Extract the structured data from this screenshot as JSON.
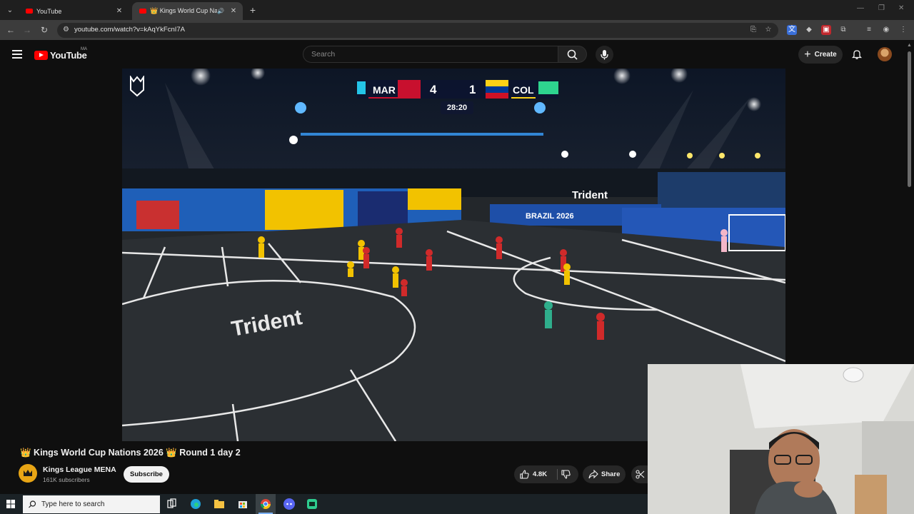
{
  "browser": {
    "tabs": [
      {
        "label": "YouTube",
        "active": false
      },
      {
        "label": "👑 Kings World Cup Natio",
        "active": true
      }
    ],
    "url": "youtube.com/watch?v=kAqYkFcnI7A"
  },
  "youtube": {
    "logo_text": "YouTube",
    "country_code": "MA",
    "search_placeholder": "Search",
    "create_label": "Create"
  },
  "video": {
    "scoreboard": {
      "home_team": "MAR",
      "home_score": "4",
      "away_team": "COL",
      "away_score": "1",
      "clock": "28:20"
    },
    "field_branding": {
      "center_logo": "Trident",
      "banner_right": "Trident",
      "board_text": "BRAZIL 2026"
    },
    "title": "👑 Kings World Cup Nations 2026 👑 Round 1 day 2",
    "channel": {
      "name": "Kings League MENA",
      "subscribers": "161K subscribers"
    },
    "subscribe_label": "Subscribe",
    "likes": "4.8K",
    "share_label": "Share"
  },
  "taskbar": {
    "search_placeholder": "Type here to search"
  },
  "colors": {
    "background": "#0f0f0f",
    "youtube_red": "#ff0000",
    "pitch": "#2b2f33",
    "morocco_red": "#c8102e",
    "colombia_yellow": "#fcd116"
  }
}
